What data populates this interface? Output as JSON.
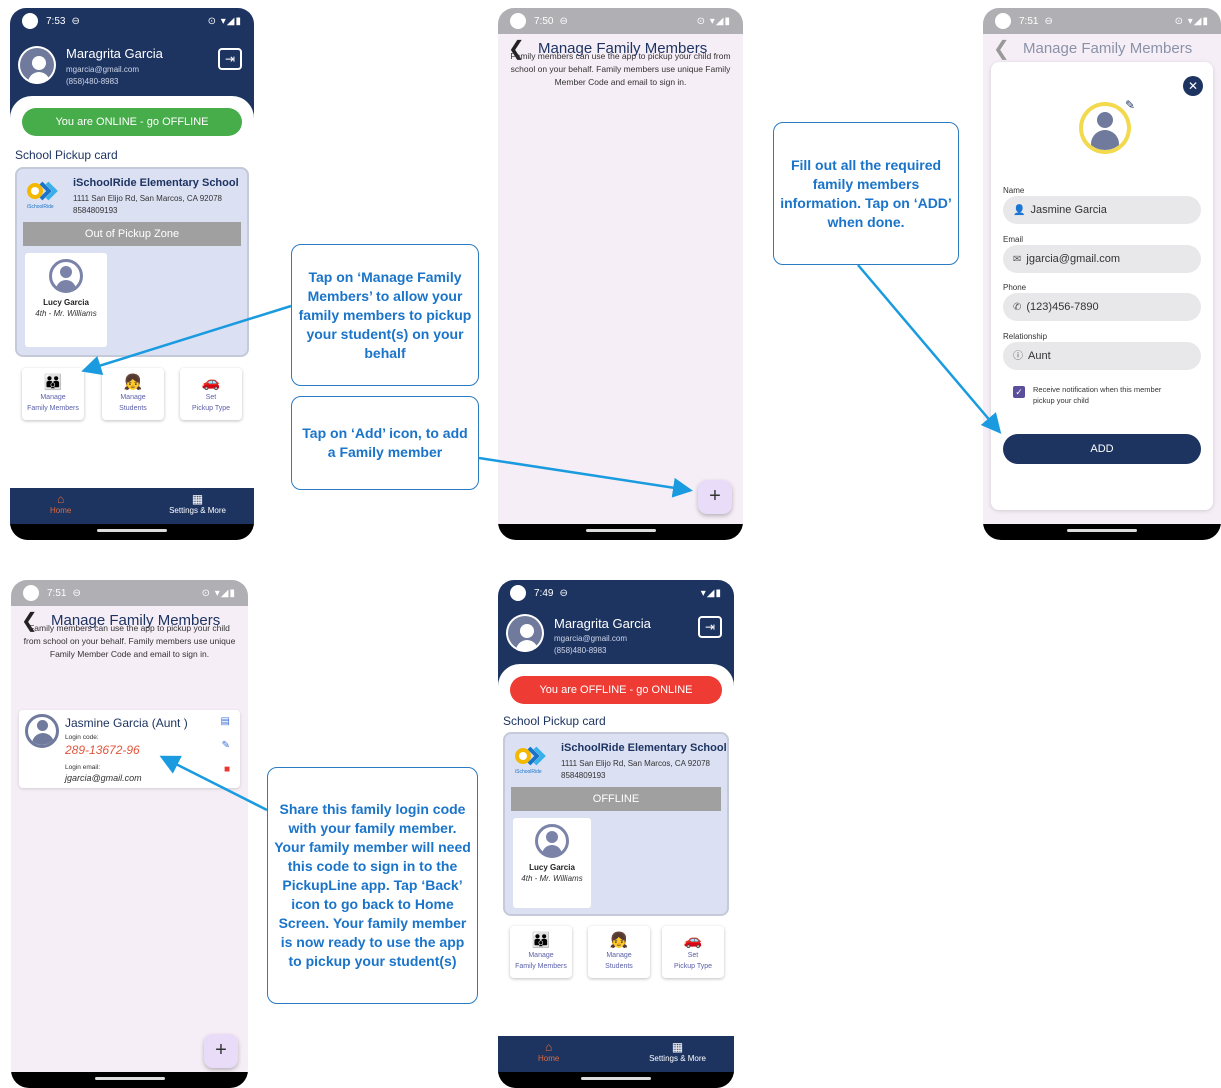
{
  "screens": {
    "home_online": {
      "status_time": "7:53",
      "user_name": "Maragrita Garcia",
      "user_email": "mgarcia@gmail.com",
      "user_phone": "(858)480-8983",
      "status_button": "You are ONLINE - go OFFLINE",
      "status_color": "#46ad4a",
      "pickup_card_title": "School Pickup card",
      "school_name": "iSchoolRide Elementary School",
      "school_address": "1111 San Elijo Rd, San Marcos, CA 92078",
      "school_phone": "8584809193",
      "zone_status": "Out of Pickup Zone",
      "student_name": "Lucy Garcia",
      "student_class": "4th - Mr. Williams",
      "actions": [
        {
          "label1": "Manage",
          "label2": "Family Members"
        },
        {
          "label1": "Manage",
          "label2": "Students"
        },
        {
          "label1": "Set",
          "label2": "Pickup Type"
        }
      ],
      "nav_home": "Home",
      "nav_settings": "Settings & More"
    },
    "manage_empty": {
      "status_time": "7:50",
      "title": "Manage Family Members",
      "description": "Family members can use the app to pickup your child from school on your behalf. Family members use unique Family Member Code and email to sign in.",
      "fab": "+"
    },
    "form": {
      "status_time": "7:51",
      "title": "Manage Family Members",
      "name_label": "Name",
      "name_value": "Jasmine Garcia",
      "email_label": "Email",
      "email_value": "jgarcia@gmail.com",
      "phone_label": "Phone",
      "phone_value": "(123)456-7890",
      "relationship_label": "Relationship",
      "relationship_value": "Aunt",
      "notify_label": "Receive notification when this member pickup your child",
      "add_button": "ADD"
    },
    "member_list": {
      "status_time": "7:51",
      "title": "Manage Family Members",
      "description": "Family members can use the app to pickup your child from school on your behalf. Family members use unique Family Member Code and email to sign in.",
      "member_name": "Jasmine Garcia (Aunt )",
      "login_code_label": "Login code:",
      "login_code": "289-13672-96",
      "login_email_label": "Login email:",
      "login_email": "jgarcia@gmail.com",
      "fab": "+"
    },
    "home_offline": {
      "status_time": "7:49",
      "user_name": "Maragrita Garcia",
      "user_email": "mgarcia@gmail.com",
      "user_phone": "(858)480-8983",
      "status_button": "You are OFFLINE - go ONLINE",
      "status_color": "#ee3b34",
      "pickup_card_title": "School Pickup card",
      "school_name": "iSchoolRide Elementary School",
      "school_address": "1111 San Elijo Rd, San Marcos, CA 92078",
      "school_phone": "8584809193",
      "zone_status": "OFFLINE",
      "student_name": "Lucy Garcia",
      "student_class": "4th - Mr. Williams",
      "actions": [
        {
          "label1": "Manage",
          "label2": "Family Members"
        },
        {
          "label1": "Manage",
          "label2": "Students"
        },
        {
          "label1": "Set",
          "label2": "Pickup Type"
        }
      ],
      "nav_home": "Home",
      "nav_settings": "Settings & More"
    }
  },
  "callouts": {
    "manage": "Tap on ‘Manage Family Members’ to allow your family members to pickup your student(s) on your behalf",
    "add": "Tap on ‘Add’ icon, to add a Family member",
    "fill": "Fill out all the required family members information. Tap on ‘ADD’ when done.",
    "share": "Share this family login code with your family member. Your family member will need this code to sign in to the PickupLine app. Tap ‘Back’ icon to go back to Home Screen. Your family member is now ready to use the app to pickup your student(s)"
  },
  "colors": {
    "navy": "#1d3461",
    "callout_blue": "#1a74c9",
    "offline_red": "#ee3b34",
    "online_green": "#46ad4a"
  }
}
